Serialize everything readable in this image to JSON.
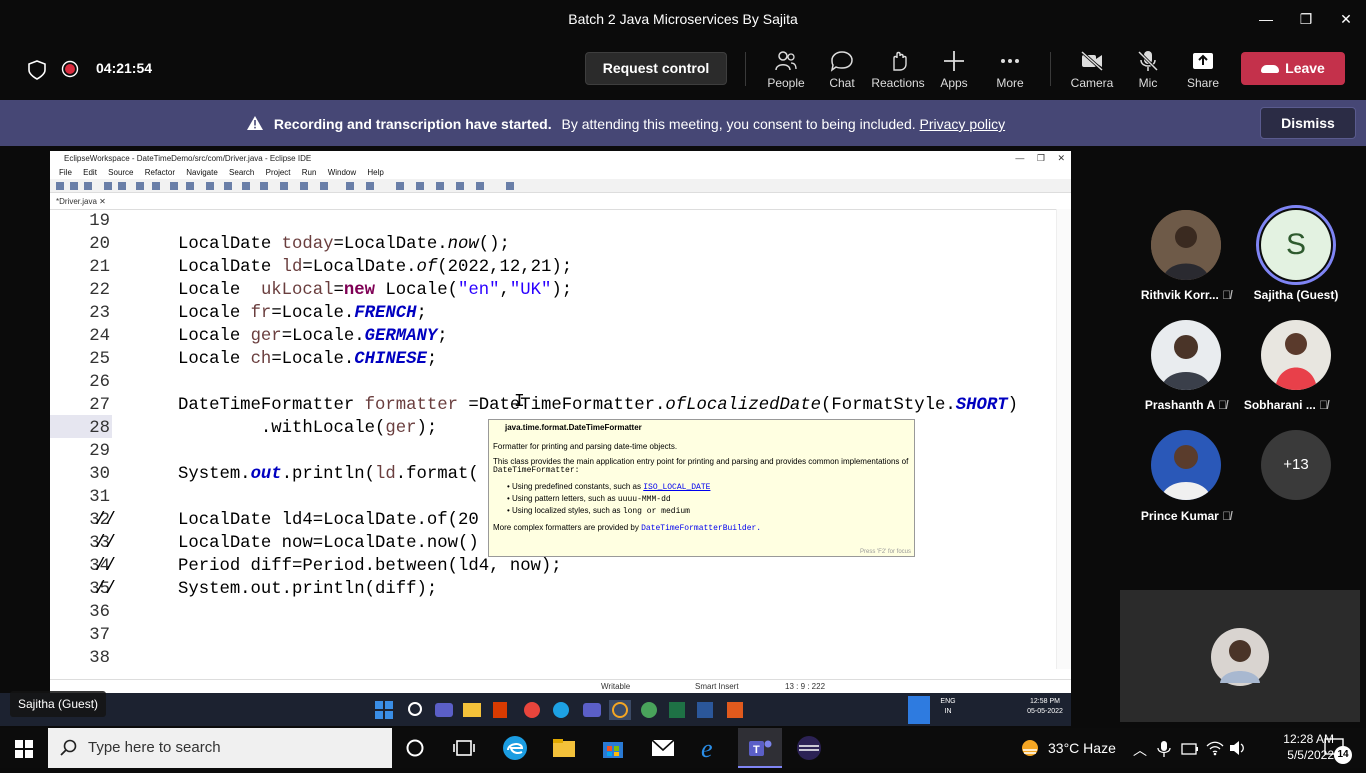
{
  "window": {
    "title": "Batch 2 Java Microservices By Sajita",
    "minimize": "—",
    "maximize": "❐",
    "close": "✕"
  },
  "meeting": {
    "timer": "04:21:54",
    "request_control": "Request control",
    "toolbar": [
      {
        "label": "People",
        "icon": "people-icon"
      },
      {
        "label": "Chat",
        "icon": "chat-icon"
      },
      {
        "label": "Reactions",
        "icon": "reactions-icon"
      },
      {
        "label": "Apps",
        "icon": "apps-icon"
      },
      {
        "label": "More",
        "icon": "more-icon"
      },
      {
        "label": "Camera",
        "icon": "camera-off-icon"
      },
      {
        "label": "Mic",
        "icon": "mic-off-icon"
      },
      {
        "label": "Share",
        "icon": "share-icon"
      }
    ],
    "leave": "Leave",
    "accent": "#c4314b"
  },
  "banner": {
    "bold": "Recording and transcription have started.",
    "text": "By attending this meeting, you consent to being included.",
    "link": "Privacy policy",
    "dismiss": "Dismiss",
    "color": "#464775"
  },
  "eclipse": {
    "title": "EclipseWorkspace - DateTimeDemo/src/com/Driver.java - Eclipse IDE",
    "menu": [
      "File",
      "Edit",
      "Source",
      "Refactor",
      "Navigate",
      "Search",
      "Project",
      "Run",
      "Window",
      "Help"
    ],
    "tab": "*Driver.java",
    "lines": [
      {
        "n": "19",
        "code": ""
      },
      {
        "n": "20",
        "code": "        LocalDate today=LocalDate.now();"
      },
      {
        "n": "21",
        "code": "        LocalDate ld=LocalDate.of(2022,12,21);"
      },
      {
        "n": "22",
        "code": "        Locale  ukLocal=new Locale(\"en\",\"UK\");"
      },
      {
        "n": "23",
        "code": "        Locale fr=Locale.FRENCH;"
      },
      {
        "n": "24",
        "code": "        Locale ger=Locale.GERMANY;"
      },
      {
        "n": "25",
        "code": "        Locale ch=Locale.CHINESE;"
      },
      {
        "n": "26",
        "code": ""
      },
      {
        "n": "27",
        "code": "        DateTimeFormatter formatter =DateTimeFormatter.ofLocalizedDate(FormatStyle.SHORT)"
      },
      {
        "n": "28",
        "code": "                .withLocale(ger);"
      },
      {
        "n": "29",
        "code": ""
      },
      {
        "n": "30",
        "code": "        System.out.println(ld.format("
      },
      {
        "n": "31",
        "code": ""
      },
      {
        "n": "32",
        "code": "//      LocalDate ld4=LocalDate.of(20"
      },
      {
        "n": "33",
        "code": "//      LocalDate now=LocalDate.now()"
      },
      {
        "n": "34",
        "code": "//      Period diff=Period.between(ld4, now);"
      },
      {
        "n": "35",
        "code": "//      System.out.println(diff);"
      },
      {
        "n": "36",
        "code": ""
      },
      {
        "n": "37",
        "code": ""
      },
      {
        "n": "38",
        "code": ""
      }
    ],
    "tooltip": {
      "title": "java.time.format.DateTimeFormatter",
      "p1": "Formatter for printing and parsing date-time objects.",
      "p2": "This class provides the main application entry point for printing and parsing and provides common implementations of",
      "p2b": "DateTimeFormatter:",
      "b1": "Using predefined constants, such as",
      "b1link": "ISO_LOCAL_DATE",
      "b2": "Using pattern letters, such as",
      "b2code": "uuuu-MMM-dd",
      "b3": "Using localized styles, such as",
      "b3code": "long or medium",
      "p3": "More complex formatters are provided by",
      "p3link": "DateTimeFormatterBuilder.",
      "hint": "Press 'F2' for focus"
    },
    "status": {
      "writable": "Writable",
      "insert": "Smart Insert",
      "pos": "13 : 9 : 222"
    }
  },
  "inner_taskbar": {
    "presenter": "Sajitha (Guest)",
    "lang": "ENG",
    "lang2": "IN",
    "time": "12:58 PM",
    "date": "05-05-2022"
  },
  "participants": [
    {
      "name": "Rithvik Korr...",
      "muted": true
    },
    {
      "name": "Sajitha (Guest)",
      "initial": "S",
      "muted": false
    },
    {
      "name": "Prashanth A",
      "muted": true
    },
    {
      "name": "Sobharani ...",
      "muted": true
    },
    {
      "name": "Prince Kumar",
      "muted": true
    }
  ],
  "overflow": "+13",
  "taskbar": {
    "search_placeholder": "Type here to search",
    "weather": "33°C  Haze",
    "time": "12:28 AM",
    "date": "5/5/2022",
    "notifications": "14"
  }
}
